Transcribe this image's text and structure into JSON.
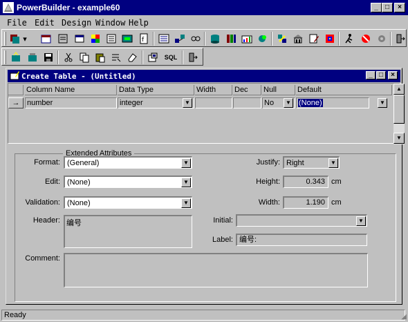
{
  "app": {
    "title": "PowerBuilder - example60",
    "icon": "powerbuilder-icon"
  },
  "menu": [
    "File",
    "Edit",
    "Design",
    "Window",
    "Help"
  ],
  "toolbar1": {
    "icons": [
      "application-icon",
      "window-icon",
      "menu-icon",
      "datawindow-icon",
      "structure-icon",
      "user-object-icon",
      "function-icon",
      "query-icon",
      "pipeline-icon",
      "project-icon",
      "database-icon",
      "database-profile-icon",
      "library-icon",
      "report-icon",
      "script-icon",
      "browser-icon",
      "debug-icon",
      "run-icon",
      "stop-icon",
      "exit-icon"
    ]
  },
  "toolbar2": {
    "icons": [
      "new-table-icon",
      "open-table-icon",
      "save-icon",
      "cut-icon",
      "copy-icon",
      "paste-icon",
      "clear-icon",
      "erase-icon",
      "properties-icon",
      "sql-icon",
      "exit-icon"
    ],
    "sql_label": "SQL"
  },
  "child": {
    "title": "Create Table - (Untitled)"
  },
  "grid": {
    "headers": [
      "Column Name",
      "Data Type",
      "Width",
      "Dec",
      "Null",
      "Default"
    ],
    "row": {
      "column_name": "number",
      "data_type": "integer",
      "width": "",
      "dec": "",
      "null": "No",
      "default": "(None)"
    }
  },
  "extended": {
    "legend": "Extended Attributes",
    "format_label": "Format:",
    "format_value": "(General)",
    "edit_label": "Edit:",
    "edit_value": "(None)",
    "validation_label": "Validation:",
    "validation_value": "(None)",
    "header_label": "Header:",
    "header_value": "编号",
    "comment_label": "Comment:",
    "comment_value": "",
    "justify_label": "Justify:",
    "justify_value": "Right",
    "height_label": "Height:",
    "height_value": "0.343",
    "height_unit": "cm",
    "width_label": "Width:",
    "width_value": "1.190",
    "width_unit": "cm",
    "initial_label": "Initial:",
    "initial_value": "",
    "label_label": "Label:",
    "label_value": "编号:"
  },
  "status": {
    "text": "Ready"
  },
  "colors": {
    "titlebar": "#000080",
    "face": "#c0c0c0",
    "selection": "#000080"
  }
}
